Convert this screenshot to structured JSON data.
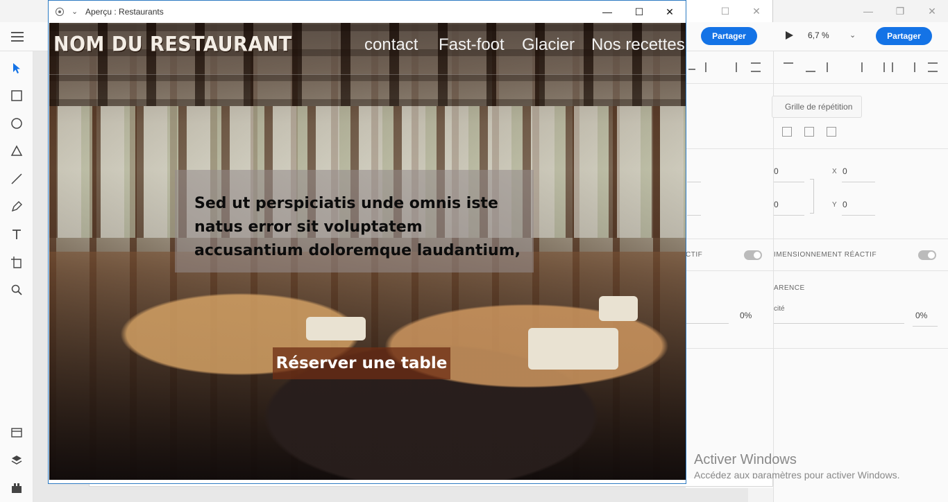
{
  "preview_window": {
    "title": "Aperçu : Restaurants",
    "site": {
      "brand": "NOM DU RESTAURANT",
      "nav": [
        "contact",
        "Fast-foot",
        "Glacier",
        "Nos recettes"
      ],
      "hero_text": "Sed ut perspiciatis unde omnis iste natus error sit voluptatem accusantium doloremque laudantium,",
      "cta": "Réserver une table"
    }
  },
  "app": {
    "share_label": "Partager",
    "zoom": "6,7 %",
    "repeat_grid": "Grille de répétition",
    "x_label": "X",
    "x_value": "0",
    "y_label": "Y",
    "y_value": "0",
    "left_partial_x": "0",
    "left_partial_y": "0",
    "responsive_left": "CTIF",
    "responsive_right": "IMENSIONNEMENT RÉACTIF",
    "transparency_label": "ARENCE",
    "opacity_label": "cité",
    "opacity_left": "0%",
    "opacity_right": "0%"
  },
  "watermark": {
    "title": "Activer Windows",
    "subtitle": "Accédez aux paramètres pour activer Windows."
  },
  "colors": {
    "accent": "#1473e6",
    "window_border": "#2b79c2",
    "cta_bg": "#6e2d14"
  }
}
